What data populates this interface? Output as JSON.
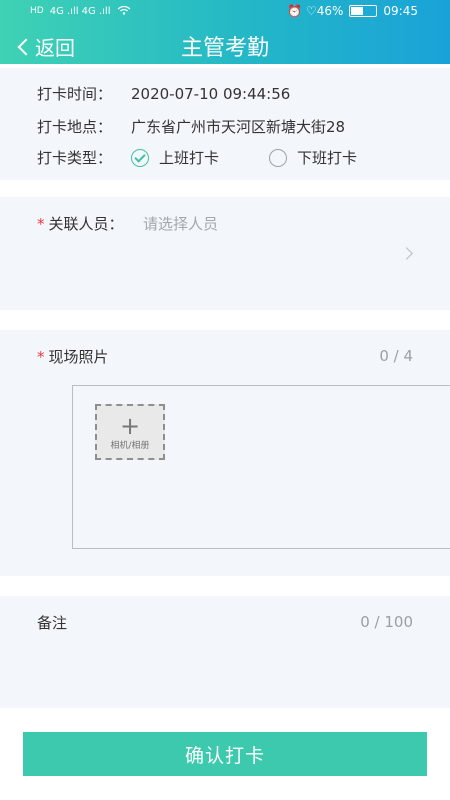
{
  "status_bar": {
    "left_sim": "HD",
    "left_signal": "4G .ıll  4G .ıll",
    "wifi_icon": "wifi-icon",
    "right_text": "⏰ ♡46%",
    "time": "09:45"
  },
  "header": {
    "back_label": "返回",
    "title": "主管考勤"
  },
  "info": {
    "time_label": "打卡时间：",
    "time_value": "2020-07-10 09:44:56",
    "location_label": "打卡地点：",
    "location_value": "广东省广州市天河区新塘大街28",
    "type_label": "打卡类型：",
    "type_options": [
      {
        "label": "上班打卡",
        "checked": true
      },
      {
        "label": "下班打卡",
        "checked": false
      }
    ]
  },
  "person": {
    "required_mark": "*",
    "label": "关联人员：",
    "placeholder": "请选择人员"
  },
  "photo": {
    "required_mark": "*",
    "label": "现场照片",
    "count": "0 / 4",
    "upload_plus": "+",
    "upload_text": "相机/相册"
  },
  "remark": {
    "label": "备注",
    "count": "0 / 100"
  },
  "confirm_label": "确认打卡",
  "colors": {
    "accent": "#3cc9ad",
    "header_start": "#3fd2b4",
    "header_end": "#1aa2d8",
    "required": "#e23b3b"
  }
}
